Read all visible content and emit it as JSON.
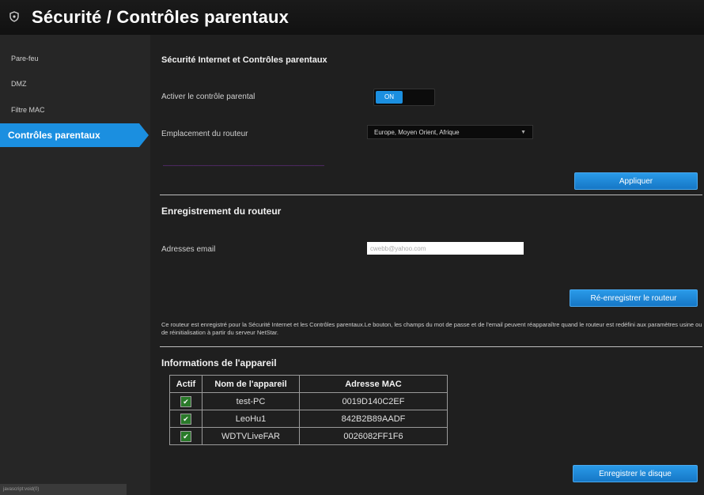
{
  "header": {
    "title": "Sécurité / Contrôles parentaux"
  },
  "sidebar": {
    "items": [
      {
        "label": "Pare-feu"
      },
      {
        "label": "DMZ"
      },
      {
        "label": "Filtre MAC"
      },
      {
        "label": "Contrôles parentaux",
        "active": true
      }
    ]
  },
  "status_bar": {
    "text": "javascript:void(0)"
  },
  "parental": {
    "heading": "Sécurité Internet et Contrôles parentaux",
    "enable_label": "Activer le contrôle parental",
    "toggle_state": "ON",
    "location_label": "Emplacement du routeur",
    "location_value": "Europe, Moyen Orient, Afrique",
    "apply_button": "Appliquer"
  },
  "registration": {
    "heading": "Enregistrement du routeur",
    "email_label": "Adresses email",
    "email_value": "cwebb@yahoo.com",
    "reregister_button": "Ré-enregistrer le routeur",
    "note": "Ce routeur est enregistré pour la Sécurité Internet et les Contrôles parentaux.Le bouton, les champs du mot de passe et de l'email peuvent réapparaître quand le routeur est redéfini aux paramètres usine ou de réinitialisation à partir du serveur NetStar."
  },
  "devices": {
    "heading": "Informations de l'appareil",
    "columns": [
      "Actif",
      "Nom de l'appareil",
      "Adresse MAC"
    ],
    "rows": [
      {
        "active": true,
        "name": "test-PC",
        "mac": "0019D140C2EF"
      },
      {
        "active": true,
        "name": "LeoHu1",
        "mac": "842B2B89AADF"
      },
      {
        "active": true,
        "name": "WDTVLiveFAR",
        "mac": "0026082FF1F6"
      }
    ],
    "save_button": "Enregistrer le disque"
  },
  "colors": {
    "accent": "#1b8fe0",
    "link": "#6b2e8c"
  }
}
